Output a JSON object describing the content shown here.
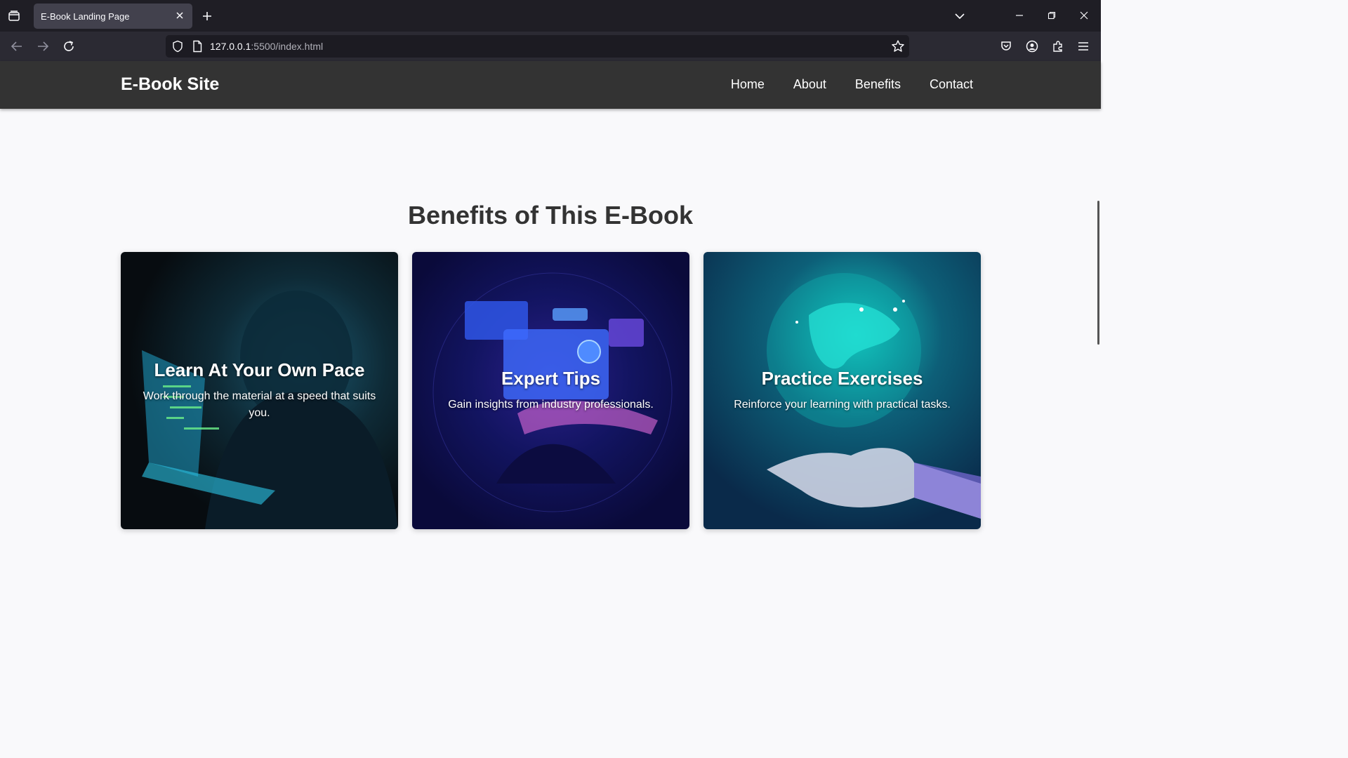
{
  "browser": {
    "tab_title": "E-Book Landing Page",
    "url_host": "127.0.0.1",
    "url_path": ":5500/index.html"
  },
  "site": {
    "brand": "E-Book Site",
    "nav": [
      "Home",
      "About",
      "Benefits",
      "Contact"
    ]
  },
  "benefits": {
    "title": "Benefits of This E-Book",
    "cards": [
      {
        "title": "Learn At Your Own Pace",
        "text": "Work through the material at a speed that suits you."
      },
      {
        "title": "Expert Tips",
        "text": "Gain insights from industry professionals."
      },
      {
        "title": "Practice Exercises",
        "text": "Reinforce your learning with practical tasks."
      }
    ]
  },
  "colors": {
    "header_bg": "#333333",
    "page_bg": "#f9f9fb",
    "title_text": "#333333"
  }
}
